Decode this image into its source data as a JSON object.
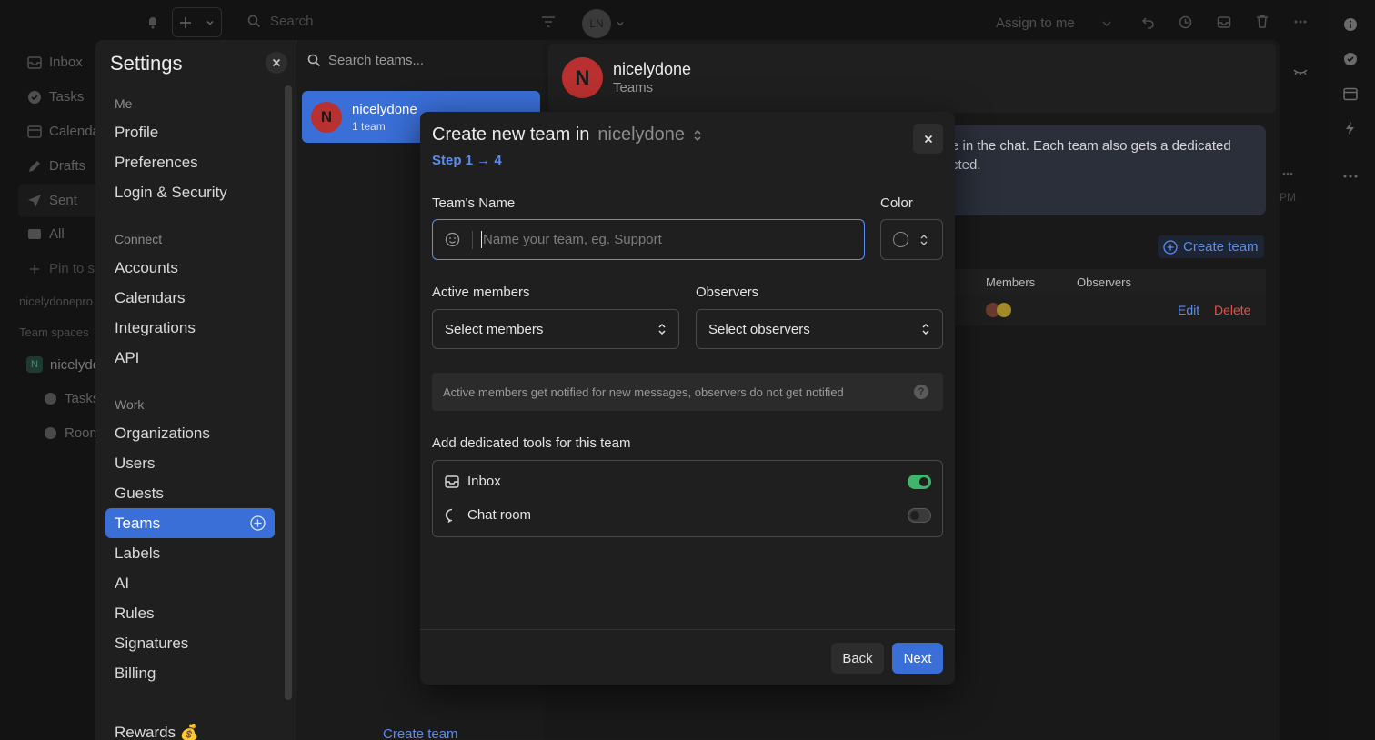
{
  "topbar": {
    "search_placeholder": "Search",
    "avatar_initials": "LN",
    "assign_label": "Assign to me"
  },
  "bg_sidebar": {
    "items": [
      "Inbox",
      "Tasks",
      "Calenda",
      "Drafts",
      "Sent",
      "All"
    ],
    "pin": "Pin to s",
    "account": "nicelydonepro",
    "team_spaces": "Team spaces",
    "team": "nicelydo",
    "team_badge": "N",
    "subitems": [
      "Tasks",
      "Room"
    ]
  },
  "settings": {
    "title": "Settings",
    "sections": {
      "me": "Me",
      "connect": "Connect",
      "work": "Work"
    },
    "me_items": [
      "Profile",
      "Preferences",
      "Login & Security"
    ],
    "connect_items": [
      "Accounts",
      "Calendars",
      "Integrations",
      "API"
    ],
    "work_items": [
      "Organizations",
      "Users",
      "Guests",
      "Teams",
      "Labels",
      "AI",
      "Rules",
      "Signatures",
      "Billing"
    ],
    "rewards": "Rewards 💰"
  },
  "teams_col": {
    "search_placeholder": "Search teams...",
    "team_name": "nicelydone",
    "team_count": "1 team",
    "team_initial": "N",
    "create_team": "Create team"
  },
  "content": {
    "org_name": "nicelydone",
    "org_sub": "Teams",
    "org_initial": "N",
    "info_line1": "e in the chat. Each team also gets a dedicated",
    "info_line2": "cted.",
    "create_team": "Create team",
    "col_members": "Members",
    "col_observers": "Observers",
    "edit": "Edit",
    "delete": "Delete",
    "pm_fragment": "PM"
  },
  "modal": {
    "title_prefix": "Create new team in",
    "org": "nicelydone",
    "step": "Step 1 → 4",
    "name_label": "Team's Name",
    "name_placeholder": "Name your team, eg. Support",
    "color_label": "Color",
    "active_label": "Active members",
    "active_select": "Select members",
    "observers_label": "Observers",
    "observers_select": "Select observers",
    "hint": "Active members get notified for new messages, observers do not get notified",
    "tools_label": "Add dedicated tools for this team",
    "tools": [
      {
        "label": "Inbox",
        "on": true
      },
      {
        "label": "Chat room",
        "on": false
      }
    ],
    "back": "Back",
    "next": "Next"
  },
  "colors": {
    "accent": "#3a6fd8",
    "link": "#5b8def",
    "danger": "#e0524a",
    "toggle_on": "#3fb46a",
    "avatar_red": "#b8302f"
  }
}
